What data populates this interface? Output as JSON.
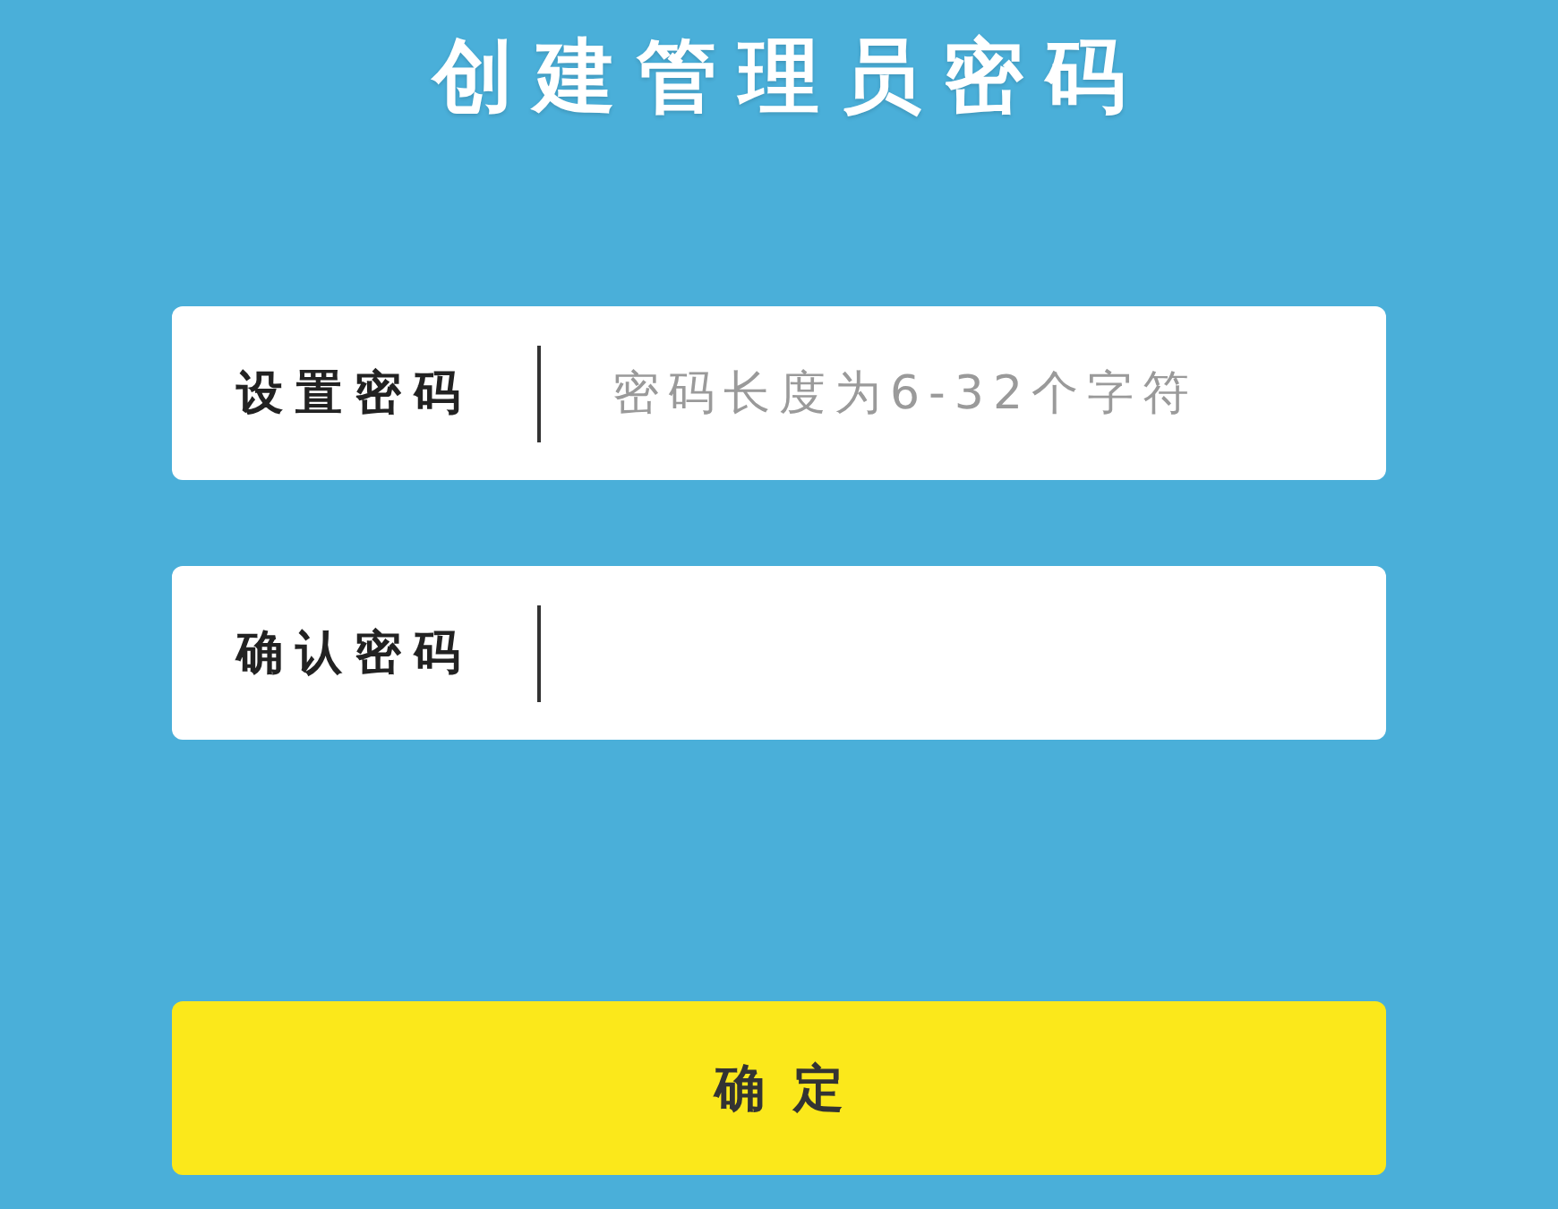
{
  "title": "创建管理员密码",
  "fields": [
    {
      "label": "设置密码",
      "placeholder": "密码长度为6-32个字符"
    },
    {
      "label": "确认密码"
    }
  ],
  "button": {
    "label": "确定"
  }
}
